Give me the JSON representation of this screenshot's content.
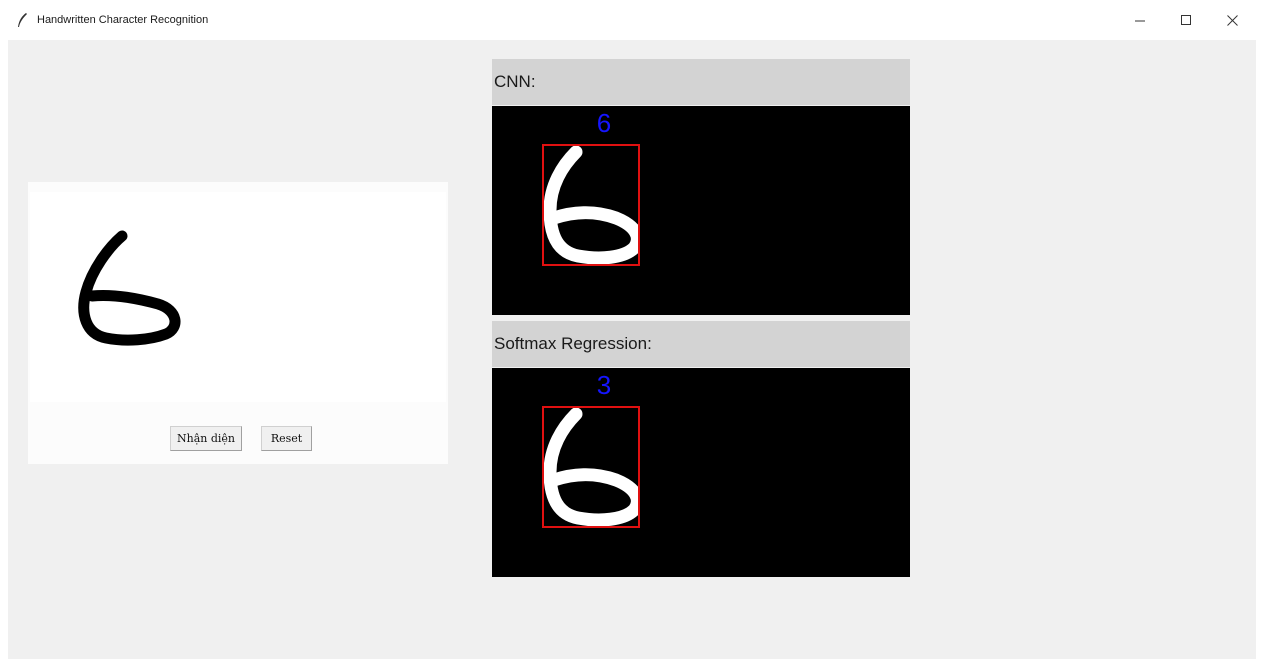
{
  "window": {
    "title": "Handwritten Character Recognition",
    "controls": [
      "minimize-icon",
      "maximize-icon",
      "close-icon"
    ]
  },
  "draw_panel": {
    "buttons": {
      "recognize_label": "Nhận diện",
      "reset_label": "Reset"
    }
  },
  "results": {
    "cnn": {
      "header": "CNN:",
      "prediction": "6"
    },
    "softmax": {
      "header": "Softmax Regression:",
      "prediction": "3"
    }
  },
  "colors": {
    "prediction_text": "#1515ff",
    "bounding_box": "#e01010",
    "header_bg": "#d3d3d3",
    "result_bg": "#000000"
  }
}
